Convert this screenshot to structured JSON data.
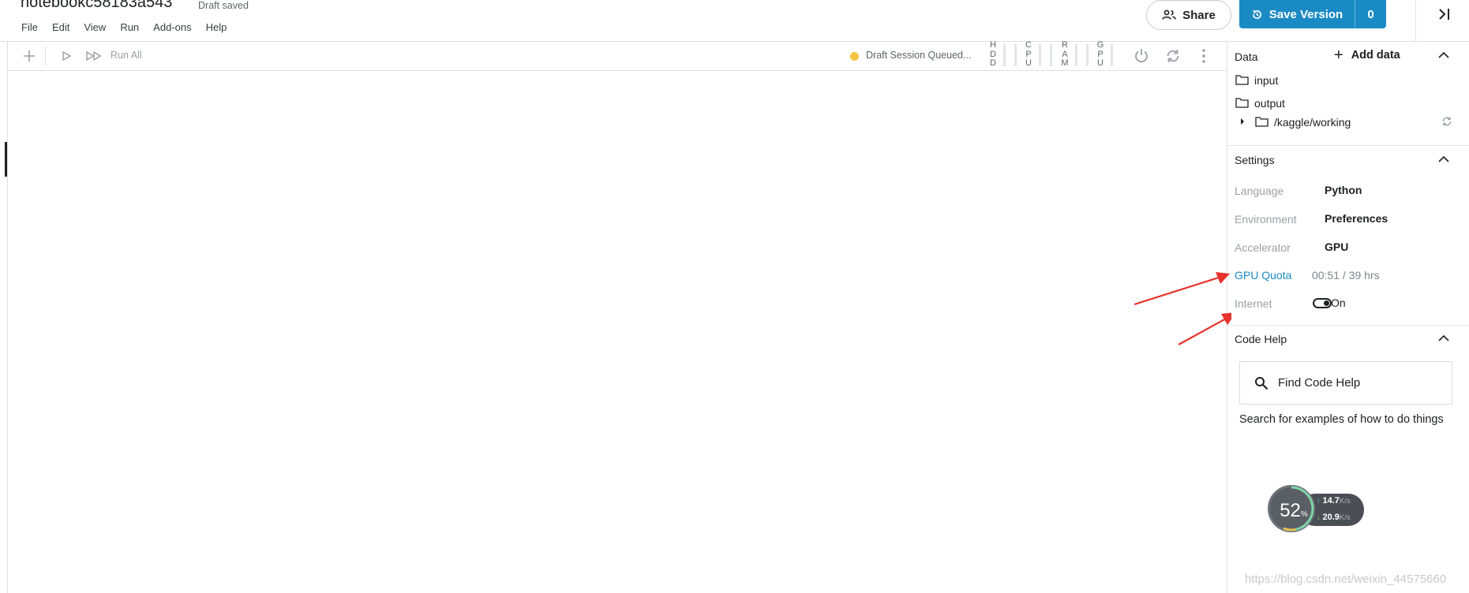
{
  "header": {
    "notebook_title": "notebookc58183a543",
    "save_status": "Draft saved",
    "menu": [
      "File",
      "Edit",
      "View",
      "Run",
      "Add-ons",
      "Help"
    ],
    "share_label": "Share",
    "save_version_label": "Save Version",
    "version_count": "0"
  },
  "toolbar": {
    "run_all_label": "Run All",
    "session_status": "Draft Session Queued...",
    "session_status_color": "#f5c543",
    "meters": [
      "HDD",
      "CPU",
      "RAM",
      "GPU"
    ]
  },
  "sidebar": {
    "data": {
      "title": "Data",
      "add_data_label": "Add data",
      "folders": [
        "input",
        "output"
      ],
      "working_path": "/kaggle/working"
    },
    "settings": {
      "title": "Settings",
      "rows": [
        {
          "label": "Language",
          "value": "Python"
        },
        {
          "label": "Environment",
          "value": "Preferences"
        },
        {
          "label": "Accelerator",
          "value": "GPU"
        }
      ],
      "gpu_quota_label": "GPU Quota",
      "gpu_quota_value": "00:51 / 39 hrs",
      "internet_label": "Internet",
      "internet_state": "On"
    },
    "code_help": {
      "title": "Code Help",
      "search_placeholder": "Find Code Help",
      "description": "Search for examples of how to do things"
    }
  },
  "network_monitor": {
    "percent": "52",
    "percent_unit": "%",
    "upload": "14.7",
    "download": "20.9",
    "unit": "K/s"
  },
  "watermark": "https://blog.csdn.net/weixin_44575660",
  "colors": {
    "accent": "#1a8ac4",
    "annotation_arrow": "#e8322b"
  }
}
